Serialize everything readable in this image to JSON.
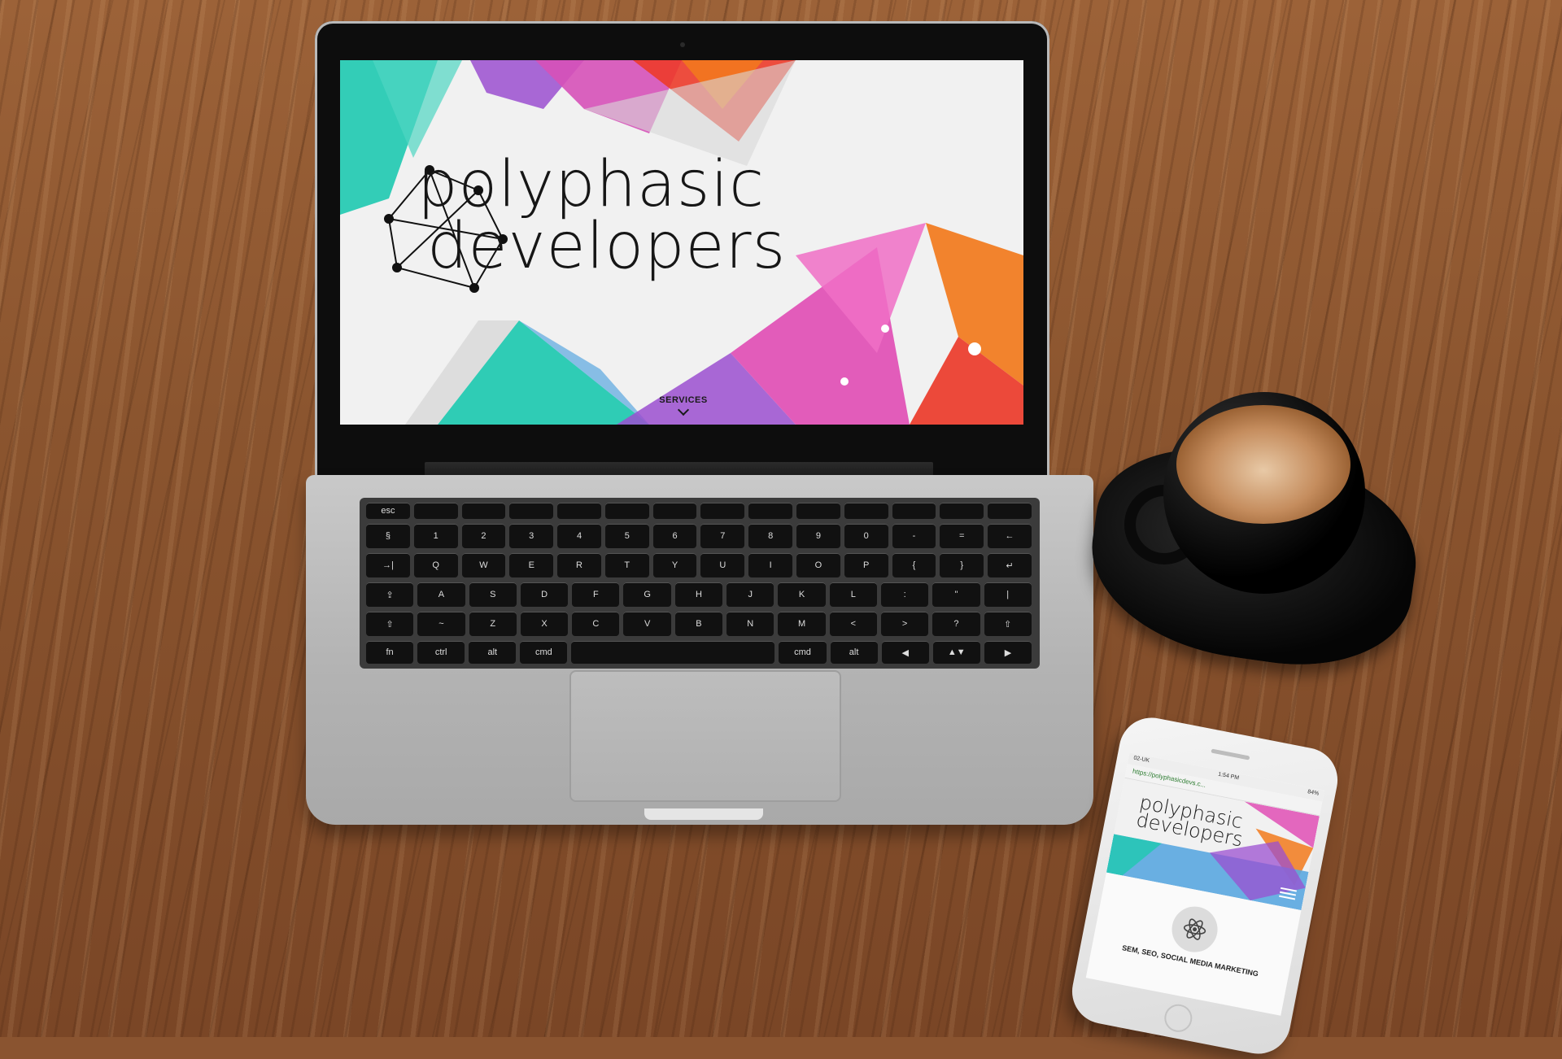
{
  "laptop_site": {
    "logo_line1": "polyphasic",
    "logo_line2": "developers",
    "nav_label": "SERVICES"
  },
  "phone_site": {
    "status_time": "1:54 PM",
    "status_left": "02-UK",
    "status_right": "84%",
    "url": "https://polyphasicdevs.c...",
    "logo_line1": "polyphasic",
    "logo_line2": "developers",
    "service_caption": "SEM, SEO, SOCIAL MEDIA MARKETING"
  },
  "keyboard": {
    "row_fn": [
      "esc",
      "",
      "",
      "",
      "",
      "",
      "",
      "",
      "",
      "",
      "",
      "",
      "",
      ""
    ],
    "row_num": [
      "§",
      "1",
      "2",
      "3",
      "4",
      "5",
      "6",
      "7",
      "8",
      "9",
      "0",
      "-",
      "=",
      "←"
    ],
    "row_q": [
      "→|",
      "Q",
      "W",
      "E",
      "R",
      "T",
      "Y",
      "U",
      "I",
      "O",
      "P",
      "{",
      "}",
      "↵"
    ],
    "row_a": [
      "⇪",
      "A",
      "S",
      "D",
      "F",
      "G",
      "H",
      "J",
      "K",
      "L",
      ":",
      "\"",
      "|"
    ],
    "row_z": [
      "⇧",
      "~",
      "Z",
      "X",
      "C",
      "V",
      "B",
      "N",
      "M",
      "<",
      ">",
      "?",
      "⇧"
    ],
    "row_bottom": [
      "fn",
      "ctrl",
      "alt",
      "cmd",
      "",
      "cmd",
      "alt",
      "◀",
      "▲▼",
      "▶"
    ]
  },
  "colors": {
    "teal": "#1ec9b0",
    "purple": "#9b4fd0",
    "magenta": "#e14fb5",
    "red": "#ec3b2a",
    "orange": "#f27a1c",
    "blue": "#5aa7e0"
  }
}
